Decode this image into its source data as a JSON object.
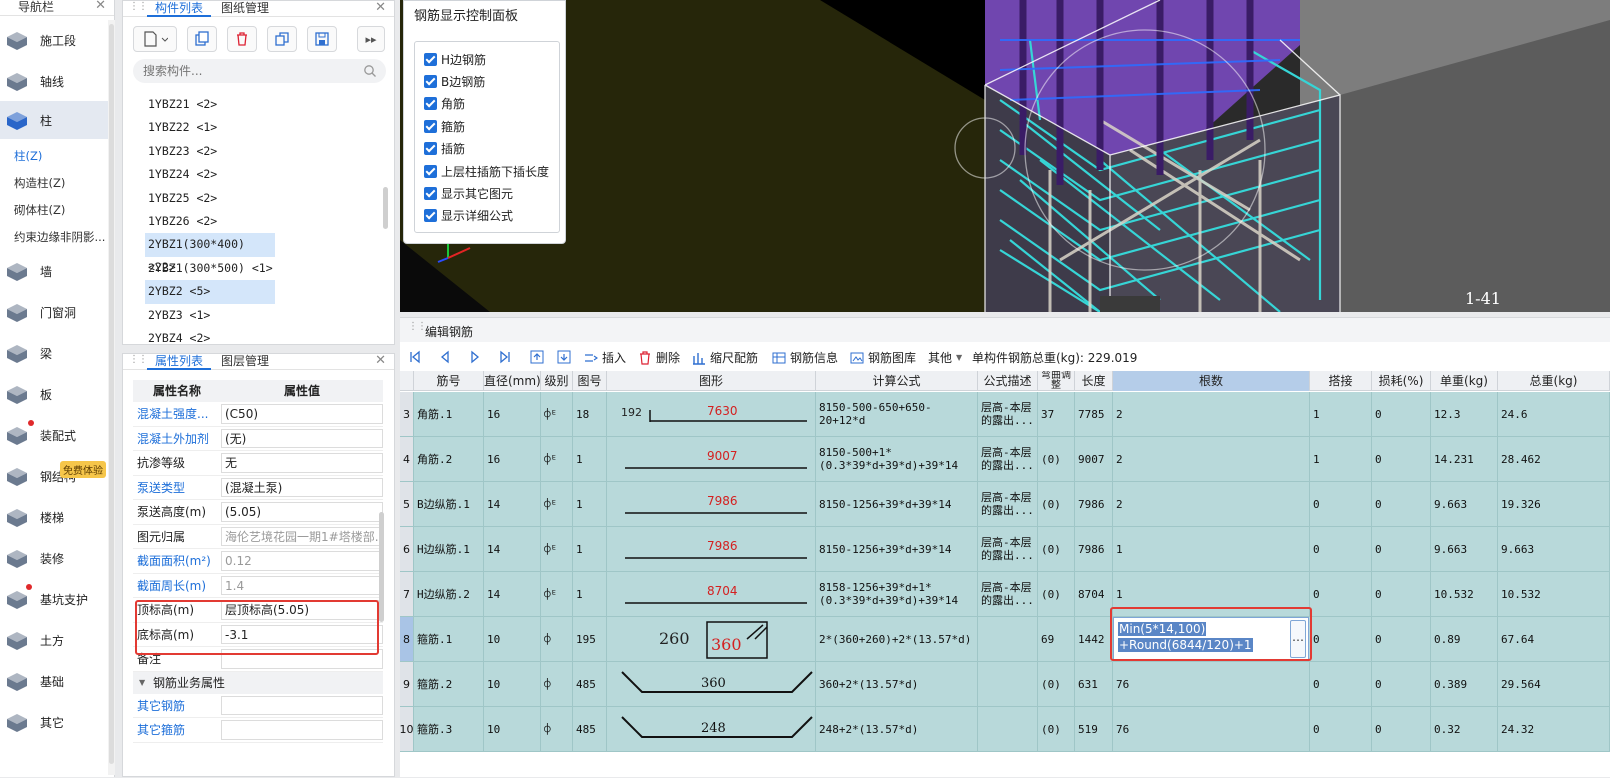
{
  "nav": {
    "title": "导航栏",
    "items": [
      {
        "label": "施工段",
        "icon": "construction-segment-icon"
      },
      {
        "label": "轴线",
        "icon": "axis-grid-icon"
      },
      {
        "label": "柱",
        "icon": "column-icon"
      },
      {
        "label": "墙",
        "icon": "wall-icon"
      },
      {
        "label": "门窗洞",
        "icon": "door-window-icon"
      },
      {
        "label": "梁",
        "icon": "beam-icon"
      },
      {
        "label": "板",
        "icon": "slab-icon"
      },
      {
        "label": "装配式",
        "icon": "prefab-icon"
      },
      {
        "label": "钢结构",
        "icon": "steel-structure-icon"
      },
      {
        "label": "楼梯",
        "icon": "stair-icon"
      },
      {
        "label": "装修",
        "icon": "decoration-icon"
      },
      {
        "label": "基坑支护",
        "icon": "pit-support-icon"
      },
      {
        "label": "土方",
        "icon": "earthwork-icon"
      },
      {
        "label": "基础",
        "icon": "foundation-icon"
      },
      {
        "label": "其它",
        "icon": "other-icon"
      }
    ],
    "sub": [
      "柱(Z)",
      "构造柱(Z)",
      "砌体柱(Z)",
      "约束边缘非阴影..."
    ],
    "trial_badge": "免费体验"
  },
  "components": {
    "tabs": [
      "构件列表",
      "图纸管理"
    ],
    "search_placeholder": "搜索构件...",
    "items": [
      "1YBZ21 <2>",
      "1YBZ22 <1>",
      "1YBZ23 <2>",
      "1YBZ24 <2>",
      "1YBZ25 <2>",
      "1YBZ26 <2>",
      "2YBZ1(300*400) <22>",
      "2YBZ1(300*500) <1>",
      "2YBZ2 <5>",
      "2YBZ3 <1>",
      "2YBZ4 <2>"
    ]
  },
  "props": {
    "tabs": [
      "属性列表",
      "图层管理"
    ],
    "head": [
      "属性名称",
      "属性值"
    ],
    "rows": [
      {
        "k": "混凝土强度...",
        "v": "(C50)",
        "link": true
      },
      {
        "k": "混凝土外加剂",
        "v": "(无)",
        "link": true
      },
      {
        "k": "抗渗等级",
        "v": "无",
        "link": false
      },
      {
        "k": "泵送类型",
        "v": "(混凝土泵)",
        "link": true
      },
      {
        "k": "泵送高度(m)",
        "v": "(5.05)",
        "link": false
      },
      {
        "k": "图元归属",
        "v": "海伦艺境花园一期1#塔楼部...",
        "link": false,
        "grey": true
      },
      {
        "k": "截面面积(m²)",
        "v": "0.12",
        "link": true,
        "grey": true
      },
      {
        "k": "截面周长(m)",
        "v": "1.4",
        "link": true,
        "grey": true
      },
      {
        "k": "顶标高(m)",
        "v": "层顶标高(5.05)",
        "link": false
      },
      {
        "k": "底标高(m)",
        "v": "-3.1",
        "link": false
      },
      {
        "k": "备注",
        "v": "",
        "link": false
      }
    ],
    "group": "钢筋业务属性",
    "rows2": [
      {
        "k": "其它钢筋",
        "v": "",
        "link": true
      },
      {
        "k": "其它箍筋",
        "v": "",
        "link": true
      }
    ]
  },
  "control_panel": {
    "title": "钢筋显示控制面板",
    "options": [
      "H边钢筋",
      "B边钢筋",
      "角筋",
      "箍筋",
      "插筋",
      "上层柱插筋下插长度",
      "显示其它图元",
      "显示详细公式"
    ]
  },
  "view": {
    "label": "1-41"
  },
  "edit": {
    "title": "编辑钢筋",
    "tools": [
      "插入",
      "删除",
      "缩尺配筋",
      "钢筋信息",
      "钢筋图库",
      "其他"
    ],
    "total_label": "单构件钢筋总重(kg): 229.019",
    "columns": [
      "",
      "筋号",
      "直径(mm)",
      "级别",
      "图号",
      "图形",
      "计算公式",
      "公式描述",
      "弯曲调整",
      "长度",
      "根数",
      "搭接",
      "损耗(%)",
      "单重(kg)",
      "总重(kg)"
    ],
    "rows": [
      {
        "n": "3",
        "name": "角筋.1",
        "d": "16",
        "grade": "⌽ᴱ",
        "fig": "18",
        "fig_left": "192",
        "fig_val": "7630",
        "formula": "8150-500-650+650-20+12*d",
        "desc": "层高-本层的露出...",
        "bend": "37",
        "len": "7785",
        "count": "2",
        "lap": "1",
        "loss": "0",
        "unit": "12.3",
        "total": "24.6"
      },
      {
        "n": "4",
        "name": "角筋.2",
        "d": "16",
        "grade": "⌽ᴱ",
        "fig": "1",
        "fig_left": "",
        "fig_val": "9007",
        "formula": "8150-500+1*(0.3*39*d+39*d)+39*14",
        "desc": "层高-本层的露出...",
        "bend": "(0)",
        "len": "9007",
        "count": "2",
        "lap": "1",
        "loss": "0",
        "unit": "14.231",
        "total": "28.462"
      },
      {
        "n": "5",
        "name": "B边纵筋.1",
        "d": "14",
        "grade": "⌽ᴱ",
        "fig": "1",
        "fig_left": "",
        "fig_val": "7986",
        "formula": "8150-1256+39*d+39*14",
        "desc": "层高-本层的露出...",
        "bend": "(0)",
        "len": "7986",
        "count": "2",
        "lap": "0",
        "loss": "0",
        "unit": "9.663",
        "total": "19.326"
      },
      {
        "n": "6",
        "name": "H边纵筋.1",
        "d": "14",
        "grade": "⌽ᴱ",
        "fig": "1",
        "fig_left": "",
        "fig_val": "7986",
        "formula": "8150-1256+39*d+39*14",
        "desc": "层高-本层的露出...",
        "bend": "(0)",
        "len": "7986",
        "count": "1",
        "lap": "0",
        "loss": "0",
        "unit": "9.663",
        "total": "9.663"
      },
      {
        "n": "7",
        "name": "H边纵筋.2",
        "d": "14",
        "grade": "⌽ᴱ",
        "fig": "1",
        "fig_left": "",
        "fig_val": "8704",
        "formula": "8158-1256+39*d+1*(0.3*39*d+39*d)+39*14",
        "desc": "层高-本层的露出...",
        "bend": "(0)",
        "len": "8704",
        "count": "1",
        "lap": "0",
        "loss": "0",
        "unit": "10.532",
        "total": "10.532"
      },
      {
        "n": "8",
        "name": "箍筋.1",
        "d": "10",
        "grade": "⌽",
        "fig": "195",
        "fig_left": "260",
        "fig_val": "360",
        "formula": "2*(360+260)+2*(13.57*d)",
        "desc": "",
        "bend": "69",
        "len": "1442",
        "count": "Min(5*14,100)\n+Round(6844/120)+1",
        "lap": "0",
        "loss": "0",
        "unit": "0.89",
        "total": "67.64"
      },
      {
        "n": "9",
        "name": "箍筋.2",
        "d": "10",
        "grade": "⌽",
        "fig": "485",
        "fig_left": "",
        "fig_val": "360",
        "formula": "360+2*(13.57*d)",
        "desc": "",
        "bend": "(0)",
        "len": "631",
        "count": "76",
        "lap": "0",
        "loss": "0",
        "unit": "0.389",
        "total": "29.564"
      },
      {
        "n": "10",
        "name": "箍筋.3",
        "d": "10",
        "grade": "⌽",
        "fig": "485",
        "fig_left": "",
        "fig_val": "248",
        "formula": "248+2*(13.57*d)",
        "desc": "",
        "bend": "(0)",
        "len": "519",
        "count": "76",
        "lap": "0",
        "loss": "0",
        "unit": "0.32",
        "total": "24.32"
      }
    ]
  }
}
